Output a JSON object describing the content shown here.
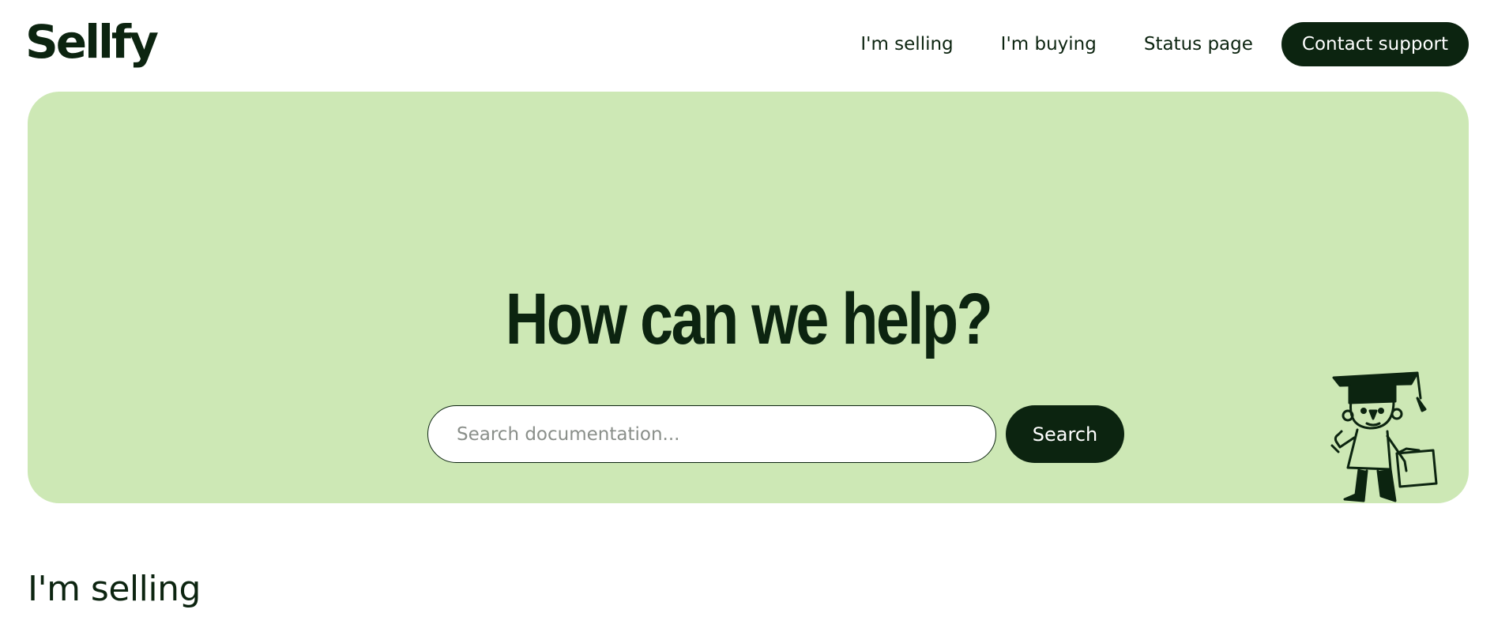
{
  "header": {
    "logo": "Sellfy",
    "nav": [
      {
        "label": "I'm selling"
      },
      {
        "label": "I'm buying"
      },
      {
        "label": "Status page"
      }
    ],
    "contact_button": "Contact support"
  },
  "hero": {
    "title": "How can we help?",
    "search": {
      "placeholder": "Search documentation...",
      "value": "",
      "button": "Search"
    },
    "mascot_icon": "graduate-mascot-illustration"
  },
  "sections": [
    {
      "title": "I'm selling"
    }
  ],
  "colors": {
    "brand_dark": "#0c2410",
    "hero_background": "#cde8b5",
    "page_background": "#ffffff"
  }
}
